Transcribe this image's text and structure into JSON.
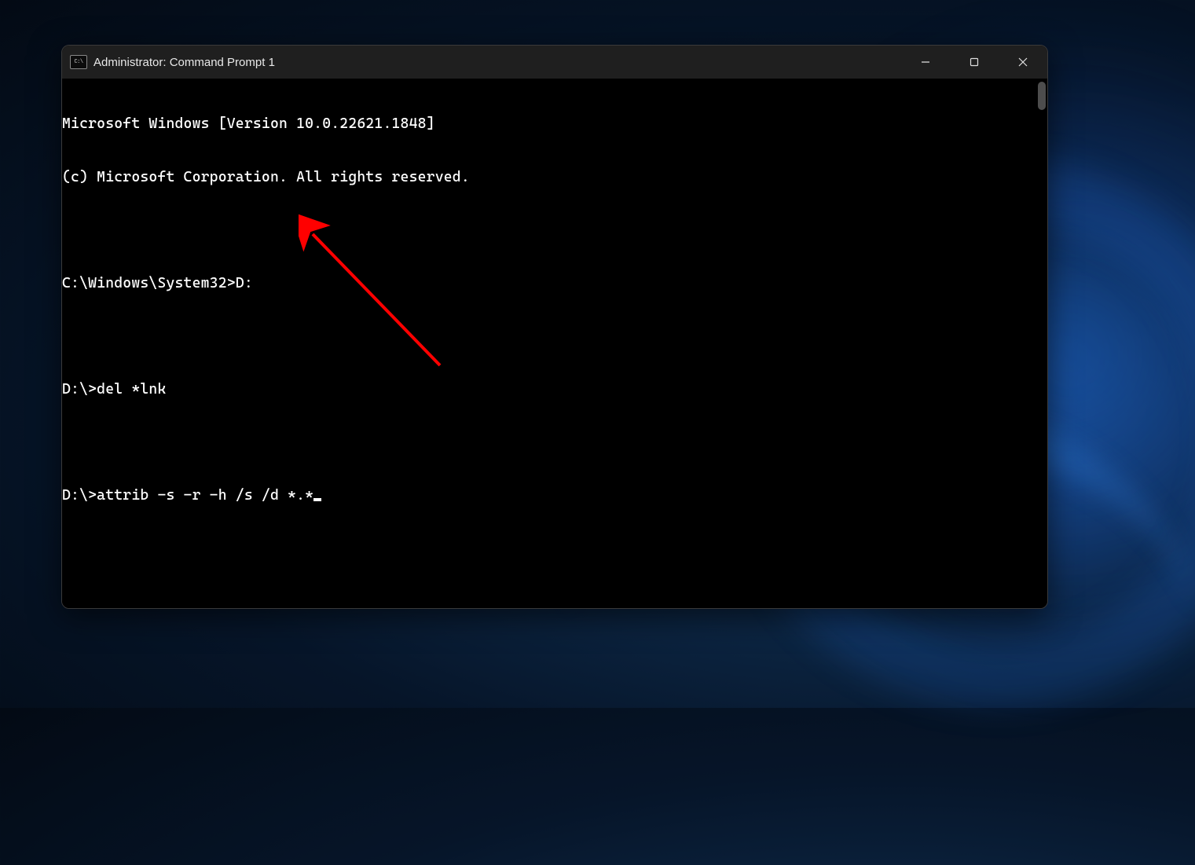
{
  "window": {
    "title": "Administrator: Command Prompt 1"
  },
  "terminal": {
    "lines": [
      "Microsoft Windows [Version 10.0.22621.1848]",
      "(c) Microsoft Corporation. All rights reserved.",
      "",
      "C:\\Windows\\System32>D:",
      "",
      "D:\\>del *lnk",
      "",
      "D:\\>attrib -s -r -h /s /d *.*"
    ]
  },
  "annotation": {
    "type": "arrow",
    "color": "#ff0000"
  }
}
